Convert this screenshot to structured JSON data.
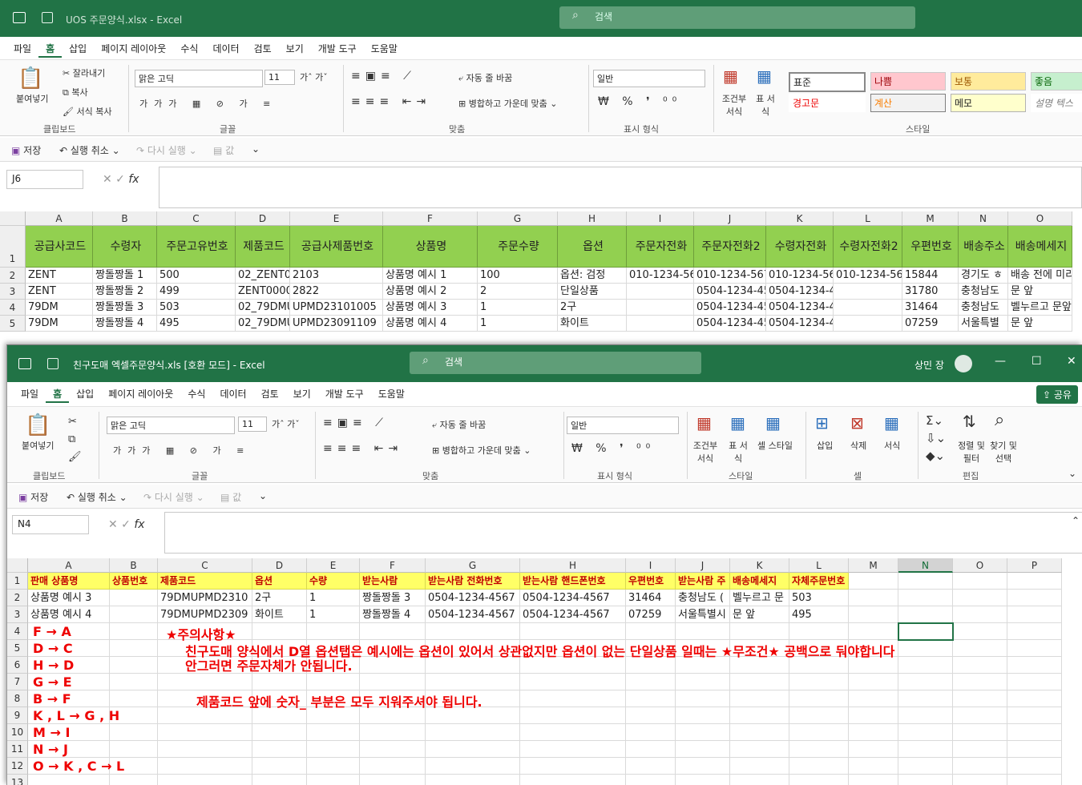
{
  "window1": {
    "title": "UOS 주문양식.xlsx  -  Excel",
    "search_placeholder": "검색",
    "tabs": [
      "파일",
      "홈",
      "삽입",
      "페이지 레이아웃",
      "수식",
      "데이터",
      "검토",
      "보기",
      "개발 도구",
      "도움말"
    ],
    "active_tab": "홈",
    "ribbon": {
      "paste_label": "붙여넣기",
      "cut_label": "잘라내기",
      "copy_label": "복사",
      "format_painter_label": "서식 복사",
      "clipboard_group": "클립보드",
      "font_name": "맑은 고딕",
      "font_size": "11",
      "font_group": "글꼴",
      "wrap_label": "자동 줄 바꿈",
      "merge_label": "병합하고 가운데 맞춤",
      "align_group": "맞춤",
      "number_format": "일반",
      "number_group": "표시 형식",
      "cond_format_label": "조건부 서식",
      "table_format_label": "표 서식",
      "styles": [
        "표준",
        "나쁨",
        "보통",
        "좋음",
        "경고문",
        "계산",
        "메모",
        "설명 텍스"
      ],
      "style_group": "스타일"
    },
    "qat": {
      "save": "저장",
      "undo": "실행 취소",
      "redo": "다시 실행",
      "value": "값"
    },
    "name_box": "J6",
    "columns": [
      "A",
      "B",
      "C",
      "D",
      "E",
      "F",
      "G",
      "H",
      "I",
      "J",
      "K",
      "L",
      "M",
      "N",
      "O"
    ],
    "rows": [
      "1",
      "2",
      "3",
      "4",
      "5"
    ],
    "header_row": [
      "공급사코드",
      "수령자",
      "주문고유번호",
      "제품코드",
      "공급사제품번호",
      "상품명",
      "주문수량",
      "옵션",
      "주문자전화",
      "주문자전화2",
      "수령자전화",
      "수령자전화2",
      "우편번호",
      "배송주소",
      "배송메세지"
    ],
    "data_rows": [
      [
        "ZENT",
        "짱돌짱돌 1",
        "500",
        "02_ZENT0",
        "2103",
        "상품명 예시 1",
        "100",
        "옵션: 검정",
        "010-1234-56",
        "010-1234-567",
        "010-1234-56",
        "010-1234-567",
        "15844",
        "경기도 ㅎ",
        "배송 전에 미리"
      ],
      [
        "ZENT",
        "짱돌짱돌 2",
        "499",
        "ZENT0000",
        "2822",
        "상품명 예시 2",
        "2",
        "단일상품",
        "",
        "0504-1234-45",
        "0504-1234-4567",
        "",
        "31780",
        "충청남도",
        "문 앞"
      ],
      [
        "79DM",
        "짱돌짱돌 3",
        "503",
        "02_79DMU",
        "UPMD23101005",
        "상품명 예시 3",
        "1",
        "2구",
        "",
        "0504-1234-45",
        "0504-1234-4567",
        "",
        "31464",
        "충청남도",
        "벨누르고 문앞"
      ],
      [
        "79DM",
        "짱돌짱돌 4",
        "495",
        "02_79DMU",
        "UPMD23091109",
        "상품명 예시 4",
        "1",
        "화이트",
        "",
        "0504-1234-45",
        "0504-1234-4567",
        "",
        "07259",
        "서울특별",
        "문 앞"
      ]
    ]
  },
  "window2": {
    "title": "친구도매 엑셀주문양식.xls  [호환 모드]  -  Excel",
    "search_placeholder": "검색",
    "user_name": "상민 장",
    "tabs": [
      "파일",
      "홈",
      "삽입",
      "페이지 레이아웃",
      "수식",
      "데이터",
      "검토",
      "보기",
      "개발 도구",
      "도움말"
    ],
    "active_tab": "홈",
    "share_label": "공유",
    "ribbon": {
      "paste_label": "붙여넣기",
      "clipboard_group": "클립보드",
      "font_name": "맑은 고딕",
      "font_size": "11",
      "font_group": "글꼴",
      "wrap_label": "자동 줄 바꿈",
      "merge_label": "병합하고 가운데 맞춤",
      "align_group": "맞춤",
      "number_format": "일반",
      "number_group": "표시 형식",
      "cond_format_label": "조건부 서식",
      "table_format_label": "표 서식",
      "cell_style_label": "셀 스타일",
      "style_group": "스타일",
      "insert_label": "삽입",
      "delete_label": "삭제",
      "format_label": "서식",
      "cell_group": "셀",
      "sort_filter_label": "정렬 및 필터",
      "find_select_label": "찾기 및 선택",
      "edit_group": "편집"
    },
    "qat": {
      "save": "저장",
      "undo": "실행 취소",
      "redo": "다시 실행",
      "value": "값"
    },
    "name_box": "N4",
    "columns": [
      "A",
      "B",
      "C",
      "D",
      "E",
      "F",
      "G",
      "H",
      "I",
      "J",
      "K",
      "L",
      "M",
      "N",
      "O",
      "P"
    ],
    "rows": [
      "1",
      "2",
      "3",
      "4",
      "5",
      "6",
      "7",
      "8",
      "9",
      "10",
      "11",
      "12",
      "13"
    ],
    "header_row": [
      "판매 상품명",
      "상품번호",
      "제품코드",
      "옵션",
      "수량",
      "받는사람",
      "받는사람 전화번호",
      "받는사람 핸드폰번호",
      "우편번호",
      "받는사람 주",
      "배송메세지",
      "자체주문번호"
    ],
    "data_rows": [
      [
        "상품명 예시 3",
        "",
        "79DMUPMD2310",
        "2구",
        "1",
        "짱돌짱돌 3",
        "0504-1234-4567",
        "0504-1234-4567",
        "31464",
        "충청남도 (",
        "벨누르고 문",
        "503"
      ],
      [
        "상품명 예시 4",
        "",
        "79DMUPMD2309",
        "화이트",
        "1",
        "짱돌짱돌 4",
        "0504-1234-4567",
        "0504-1234-4567",
        "07259",
        "서울특별시",
        "문 앞",
        "495"
      ]
    ],
    "mapping_notes": [
      "F → A",
      "D → C",
      "H → D",
      "G → E",
      "B → F",
      "K , L → G , H",
      "M → I",
      "N → J",
      "O → K , C → L"
    ],
    "warning": {
      "title": "★주의사항★",
      "line1": "친구도매 양식에서 D열 옵션탭은 예시에는 옵션이 있어서 상관없지만 옵션이 없는 단일상품 일때는 ★무조건★ 공백으로 둬야합니다",
      "line2": "안그러면 주문자체가 안됩니다.",
      "line3": "제품코드 앞에 숫자_ 부분은 모두 지워주셔야 됩니다."
    }
  }
}
